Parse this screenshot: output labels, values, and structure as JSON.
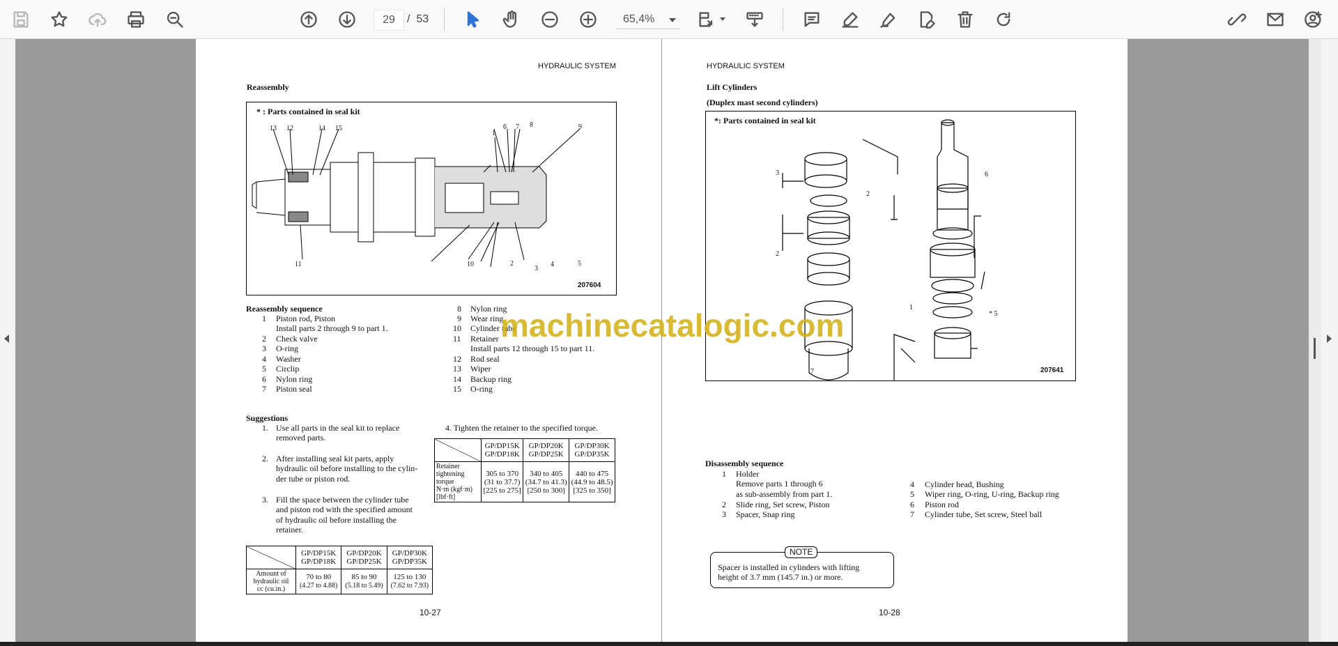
{
  "toolbar": {
    "page_current": "29",
    "page_separator": "/",
    "page_total": "53",
    "zoom": "65,4%"
  },
  "watermark": "machinecatalogic.com",
  "left_page": {
    "header": "HYDRAULIC SYSTEM",
    "section_title": "Reassembly",
    "figure_note": "* : Parts contained in seal kit",
    "figure_id": "207604",
    "callouts": [
      "13",
      "12",
      "14",
      "15",
      "1",
      "6",
      "7",
      "8",
      "9",
      "11",
      "10",
      "2",
      "3",
      "4",
      "5"
    ],
    "sequence_title": "Reassembly sequence",
    "sequence_col1": [
      {
        "num": "1",
        "text": "Piston rod, Piston"
      },
      {
        "num": "",
        "text": "Install parts 2 through 9 to part 1."
      },
      {
        "num": "2",
        "text": "Check valve"
      },
      {
        "num": "3",
        "text": "O-ring"
      },
      {
        "num": "4",
        "text": "Washer"
      },
      {
        "num": "5",
        "text": "Circlip"
      },
      {
        "num": "6",
        "text": "Nylon ring"
      },
      {
        "num": "7",
        "text": "Piston seal"
      }
    ],
    "sequence_col2": [
      {
        "num": "8",
        "text": "Nylon ring"
      },
      {
        "num": "9",
        "text": "Wear ring"
      },
      {
        "num": "10",
        "text": "Cylinder tube"
      },
      {
        "num": "11",
        "text": "Retainer"
      },
      {
        "num": "",
        "text": "Install parts 12 through 15 to part 11."
      },
      {
        "num": "12",
        "text": "Rod seal"
      },
      {
        "num": "13",
        "text": "Wiper"
      },
      {
        "num": "14",
        "text": "Backup ring"
      },
      {
        "num": "15",
        "text": "O-ring"
      }
    ],
    "suggestions_title": "Suggestions",
    "suggestions": [
      {
        "num": "1.",
        "lines": [
          "Use all parts in the seal kit to replace",
          "removed parts."
        ]
      },
      {
        "num": "2.",
        "lines": [
          "After installing seal kit parts, apply",
          "hydraulic oil before installing to the cylin-",
          "der tube or piston rod."
        ]
      },
      {
        "num": "3.",
        "lines": [
          "Fill the space between the cylinder tube",
          "and piston rod with the specified amount",
          "of hydraulic oil before installing the",
          "retainer."
        ]
      }
    ],
    "step4": "4. Tighten the retainer to the specified torque.",
    "torque_table": {
      "headers": [
        [
          "GP/DP15K",
          "GP/DP18K"
        ],
        [
          "GP/DP20K",
          "GP/DP25K"
        ],
        [
          "GP/DP30K",
          "GP/DP35K"
        ]
      ],
      "row_label": [
        "Retainer",
        "tightening",
        "torque",
        "N·m (kgf·m)",
        "[lbf·ft]"
      ],
      "cells": [
        [
          "305 to 370",
          "(31 to 37.7)",
          "[225 to 275]"
        ],
        [
          "340 to 405",
          "(34.7 to 41.3)",
          "[250 to 300]"
        ],
        [
          "440 to 475",
          "(44.9 to 48.5)",
          "[325 to 350]"
        ]
      ]
    },
    "oil_table": {
      "headers": [
        [
          "GP/DP15K",
          "GP/DP18K"
        ],
        [
          "GP/DP20K",
          "GP/DP25K"
        ],
        [
          "GP/DP30K",
          "GP/DP35K"
        ]
      ],
      "row_label": [
        "Amount of",
        "hydraulic oil",
        "cc (cu.in.)"
      ],
      "cells": [
        [
          "70 to 80",
          "(4.27 to 4.88)"
        ],
        [
          "85 to 90",
          "(5.18 to 5.49)"
        ],
        [
          "125 to 130",
          "(7.62 to 7.93)"
        ]
      ]
    },
    "page_number": "10-27"
  },
  "right_page": {
    "header": "HYDRAULIC SYSTEM",
    "section_title": "Lift Cylinders",
    "subtitle": "(Duplex mast second cylinders)",
    "figure_note": "*: Parts contained in seal kit",
    "figure_id": "207641",
    "callouts": [
      "3",
      "2",
      "2",
      "1",
      "* 5",
      "6",
      "7",
      "7",
      "4"
    ],
    "sequence_title": "Disassembly sequence",
    "sequence_col1": [
      {
        "num": "1",
        "text": "Holder"
      },
      {
        "num": "",
        "text": "Remove parts 1 through 6"
      },
      {
        "num": "",
        "text": "as sub-assembly from part 1."
      },
      {
        "num": "2",
        "text": "Slide ring, Set screw, Piston"
      },
      {
        "num": "3",
        "text": "Spacer, Snap ring"
      }
    ],
    "sequence_col2": [
      {
        "num": "4",
        "text": "Cylinder head, Bushing"
      },
      {
        "num": "5",
        "text": "Wiper ring, O-ring, U-ring, Backup ring"
      },
      {
        "num": "6",
        "text": "Piston rod"
      },
      {
        "num": "7",
        "text": "Cylinder tube, Set screw, Steel ball"
      }
    ],
    "note_label": "NOTE",
    "note_lines": [
      "Spacer is installed in cylinders with lifting",
      "height of 3.7 mm (145.7 in.) or more."
    ],
    "page_number": "10-28"
  }
}
